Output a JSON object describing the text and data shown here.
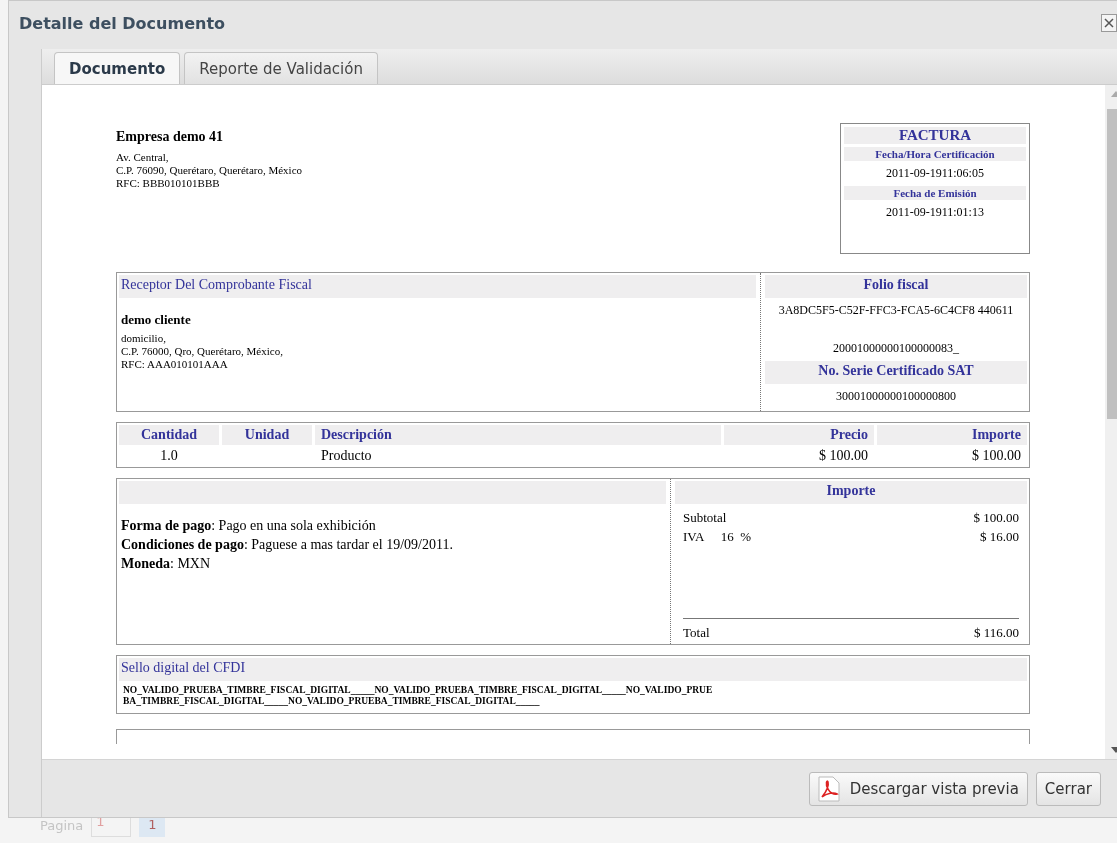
{
  "dialog": {
    "title": "Detalle del Documento"
  },
  "tabs": [
    {
      "label": "Documento",
      "selected": true
    },
    {
      "label": "Reporte de Validación",
      "selected": false
    }
  ],
  "document": {
    "issuer": {
      "name": "Empresa demo 41",
      "lines": [
        "Av. Central,",
        "C.P. 76090, Querétaro, Querétaro, México",
        "RFC: BBB010101BBB"
      ]
    },
    "invoice_box": {
      "title": "FACTURA",
      "fields": [
        {
          "label": "Fecha/Hora Certificación",
          "value": "2011-09-1911:06:05"
        },
        {
          "label": "Fecha de Emisión",
          "value": "2011-09-1911:01:13"
        }
      ]
    },
    "receiver": {
      "heading": "Receptor Del Comprobante Fiscal",
      "name": "demo cliente",
      "lines": [
        "domicilio,",
        "C.P. 76000, Qro, Querétaro, México,",
        "RFC: AAA010101AAA"
      ]
    },
    "fiscal": {
      "folio_heading": "Folio fiscal",
      "folio": "3A8DC5F5-C52F-FFC3-FCA5-6C4CF8 440611",
      "certificate_number": "20001000000100000083_",
      "sat_heading": "No. Serie Certificado SAT",
      "sat_serial": "30001000000100000800"
    },
    "items": {
      "columns": {
        "quantity": "Cantidad",
        "unit": "Unidad",
        "description": "Descripción",
        "price": "Precio",
        "amount": "Importe"
      },
      "rows": [
        {
          "quantity": "1.0",
          "description": "Producto",
          "price": "$ 100.00",
          "amount": "$ 100.00"
        }
      ]
    },
    "payment": {
      "lines": [
        "**Forma de pago**: Pago en una sola exhibición",
        "**Condiciones de pago**: Paguese a mas tardar el 19/09/2011.",
        "**Moneda**: MXN"
      ]
    },
    "totals": {
      "heading": "Importe",
      "rows": [
        {
          "label": "Subtotal",
          "value": "$ 100.00"
        },
        {
          "label": "IVA",
          "rate": "16",
          "unit": "%",
          "value": "$ 16.00"
        }
      ],
      "total": {
        "label": "Total",
        "value": "$ 116.00"
      }
    },
    "seal": {
      "heading": "Sello digital del CFDI",
      "lines": [
        "NO_VALIDO_PRUEBA_TIMBRE_FISCAL_DIGITAL_____NO_VALIDO_PRUEBA_TIMBRE_FISCAL_DIGITAL_____NO_VALIDO_PRUE",
        "BA_TIMBRE_FISCAL_DIGITAL_____NO_VALIDO_PRUEBA_TIMBRE_FISCAL_DIGITAL_____"
      ]
    }
  },
  "footer": {
    "buttons": [
      {
        "kind": "pdf",
        "label": "Descargar vista previa"
      },
      {
        "kind": "plain",
        "label": "Cerrar"
      }
    ]
  },
  "background_pager": {
    "label": "Pagina",
    "page": "1",
    "current": "1"
  }
}
